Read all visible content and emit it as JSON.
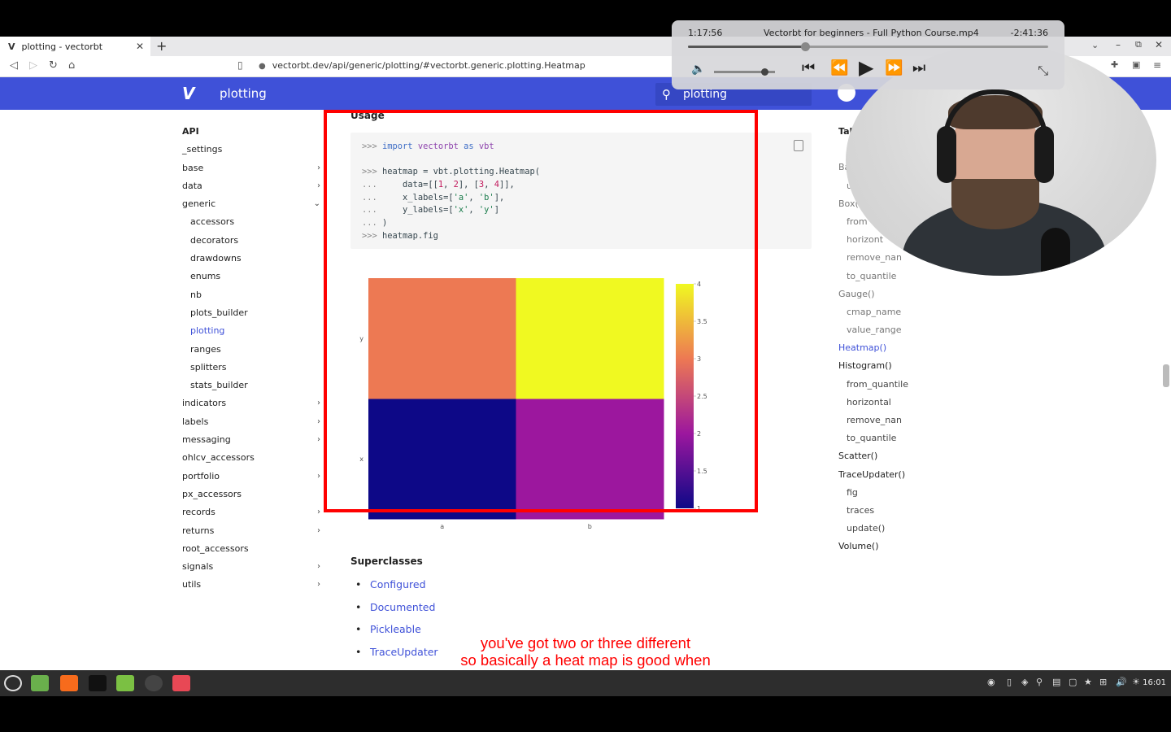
{
  "browser": {
    "tab_title": "plotting - vectorbt",
    "tab_logo": "V",
    "url": "vectorbt.dev/api/generic/plotting/#vectorbt.generic.plotting.Heatmap"
  },
  "site": {
    "logo": "V",
    "title": "plotting",
    "search_value": "plotting"
  },
  "nav": {
    "items": [
      {
        "label": "API",
        "level": "head"
      },
      {
        "label": "_settings",
        "level": "top"
      },
      {
        "label": "base",
        "level": "top",
        "chev": "›"
      },
      {
        "label": "data",
        "level": "top",
        "chev": "›"
      },
      {
        "label": "generic",
        "level": "top",
        "chev": "⌄"
      },
      {
        "label": "accessors",
        "level": "sub"
      },
      {
        "label": "decorators",
        "level": "sub"
      },
      {
        "label": "drawdowns",
        "level": "sub"
      },
      {
        "label": "enums",
        "level": "sub"
      },
      {
        "label": "nb",
        "level": "sub"
      },
      {
        "label": "plots_builder",
        "level": "sub"
      },
      {
        "label": "plotting",
        "level": "sub",
        "active": true
      },
      {
        "label": "ranges",
        "level": "sub"
      },
      {
        "label": "splitters",
        "level": "sub"
      },
      {
        "label": "stats_builder",
        "level": "sub"
      },
      {
        "label": "indicators",
        "level": "top",
        "chev": "›"
      },
      {
        "label": "labels",
        "level": "top",
        "chev": "›"
      },
      {
        "label": "messaging",
        "level": "top",
        "chev": "›"
      },
      {
        "label": "ohlcv_accessors",
        "level": "top"
      },
      {
        "label": "portfolio",
        "level": "top",
        "chev": "›"
      },
      {
        "label": "px_accessors",
        "level": "top"
      },
      {
        "label": "records",
        "level": "top",
        "chev": "›"
      },
      {
        "label": "returns",
        "level": "top",
        "chev": "›"
      },
      {
        "label": "root_accessors",
        "level": "top"
      },
      {
        "label": "signals",
        "level": "top",
        "chev": "›"
      },
      {
        "label": "utils",
        "level": "top",
        "chev": "›"
      }
    ]
  },
  "main": {
    "usage_heading": "Usage",
    "code_lines": [
      {
        "parts": [
          {
            "t": ">>> ",
            "c": "pr"
          },
          {
            "t": "import",
            "c": "kw"
          },
          {
            "t": " vectorbt ",
            "c": "nm2"
          },
          {
            "t": "as",
            "c": "kw"
          },
          {
            "t": " vbt",
            "c": "nm2"
          }
        ]
      },
      {
        "parts": [
          {
            "t": "",
            "c": ""
          }
        ]
      },
      {
        "parts": [
          {
            "t": ">>> ",
            "c": "pr"
          },
          {
            "t": "heatmap = vbt.plotting.Heatmap(",
            "c": ""
          }
        ]
      },
      {
        "parts": [
          {
            "t": "...     ",
            "c": "pr"
          },
          {
            "t": "data=[[",
            "c": ""
          },
          {
            "t": "1",
            "c": "nm"
          },
          {
            "t": ", ",
            "c": ""
          },
          {
            "t": "2",
            "c": "nm"
          },
          {
            "t": "], [",
            "c": ""
          },
          {
            "t": "3",
            "c": "nm"
          },
          {
            "t": ", ",
            "c": ""
          },
          {
            "t": "4",
            "c": "nm"
          },
          {
            "t": "]],",
            "c": ""
          }
        ]
      },
      {
        "parts": [
          {
            "t": "...     ",
            "c": "pr"
          },
          {
            "t": "x_labels=[",
            "c": ""
          },
          {
            "t": "'a'",
            "c": "st"
          },
          {
            "t": ", ",
            "c": ""
          },
          {
            "t": "'b'",
            "c": "st"
          },
          {
            "t": "],",
            "c": ""
          }
        ]
      },
      {
        "parts": [
          {
            "t": "...     ",
            "c": "pr"
          },
          {
            "t": "y_labels=[",
            "c": ""
          },
          {
            "t": "'x'",
            "c": "st"
          },
          {
            "t": ", ",
            "c": ""
          },
          {
            "t": "'y'",
            "c": "st"
          },
          {
            "t": "]",
            "c": ""
          }
        ]
      },
      {
        "parts": [
          {
            "t": "... ",
            "c": "pr"
          },
          {
            "t": ")",
            "c": ""
          }
        ]
      },
      {
        "parts": [
          {
            "t": ">>> ",
            "c": "pr"
          },
          {
            "t": "heatmap.fig",
            "c": ""
          }
        ]
      }
    ],
    "superclasses_heading": "Superclasses",
    "superclasses": [
      "Configured",
      "Documented",
      "Pickleable",
      "TraceUpdater"
    ]
  },
  "chart_data": {
    "type": "heatmap",
    "x_categories": [
      "a",
      "b"
    ],
    "y_categories": [
      "x",
      "y"
    ],
    "values": [
      [
        1,
        2
      ],
      [
        3,
        4
      ]
    ],
    "colorbar_ticks": [
      "1",
      "1.5",
      "2",
      "2.5",
      "3",
      "3.5",
      "4"
    ],
    "zlim": [
      1,
      4
    ],
    "colorscale": [
      "#0d0887",
      "#9c179e",
      "#ed7953",
      "#f0f921"
    ]
  },
  "toc": {
    "items": [
      {
        "label": "Tab",
        "cls": "head"
      },
      {
        "label": "cl",
        "cls": "sub dim"
      },
      {
        "label": "Ba",
        "cls": "dim"
      },
      {
        "label": "u",
        "cls": "sub dim"
      },
      {
        "label": "Box(",
        "cls": "dim"
      },
      {
        "label": "from",
        "cls": "sub dim"
      },
      {
        "label": "horizont",
        "cls": "sub dim"
      },
      {
        "label": "remove_nan",
        "cls": "sub dim"
      },
      {
        "label": "to_quantile",
        "cls": "sub dim"
      },
      {
        "label": "Gauge()",
        "cls": "dim"
      },
      {
        "label": "cmap_name",
        "cls": "sub dim"
      },
      {
        "label": "value_range",
        "cls": "sub dim"
      },
      {
        "label": "Heatmap()",
        "cls": "active"
      },
      {
        "label": "Histogram()",
        "cls": ""
      },
      {
        "label": "from_quantile",
        "cls": "sub"
      },
      {
        "label": "horizontal",
        "cls": "sub"
      },
      {
        "label": "remove_nan",
        "cls": "sub"
      },
      {
        "label": "to_quantile",
        "cls": "sub"
      },
      {
        "label": "Scatter()",
        "cls": ""
      },
      {
        "label": "TraceUpdater()",
        "cls": ""
      },
      {
        "label": "fig",
        "cls": "sub"
      },
      {
        "label": "traces",
        "cls": "sub"
      },
      {
        "label": "update()",
        "cls": "sub"
      },
      {
        "label": "Volume()",
        "cls": ""
      }
    ]
  },
  "player": {
    "elapsed": "1:17:56",
    "title": "Vectorbt for beginners - Full Python Course.mp4",
    "remaining": "-2:41:36",
    "progress": 0.325,
    "volume": 0.83
  },
  "subtitles": {
    "line1": "you've got two or three different",
    "line2": "so basically a heat map is good when"
  },
  "taskbar": {
    "clock": "16:01"
  }
}
